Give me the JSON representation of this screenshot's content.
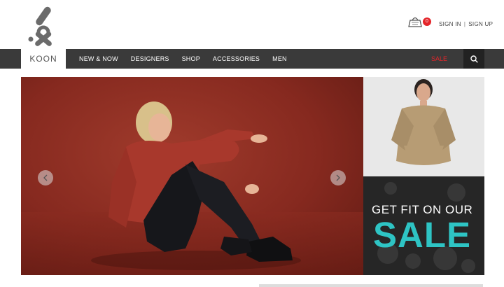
{
  "brand": {
    "name": "KOON"
  },
  "header": {
    "cart_count": "0",
    "sign_in": "SIGN IN",
    "separator": "|",
    "sign_up": "SIGN UP"
  },
  "nav": {
    "items": [
      {
        "label": "NEW & NOW"
      },
      {
        "label": "DESIGNERS"
      },
      {
        "label": "SHOP"
      },
      {
        "label": "ACCESSORIES"
      },
      {
        "label": "MEN"
      }
    ],
    "sale": "SALE",
    "search_icon": "search-icon"
  },
  "hero": {
    "prev_icon": "chevron-left-icon",
    "next_icon": "chevron-right-icon"
  },
  "promo": {
    "line1": "GET FIT ON OUR",
    "line2": "SALE"
  },
  "colors": {
    "nav_bg": "#3a3a3a",
    "sale_red": "#e4252a",
    "promo_teal": "#2ec4c4",
    "hero_red": "#8b2d22"
  }
}
